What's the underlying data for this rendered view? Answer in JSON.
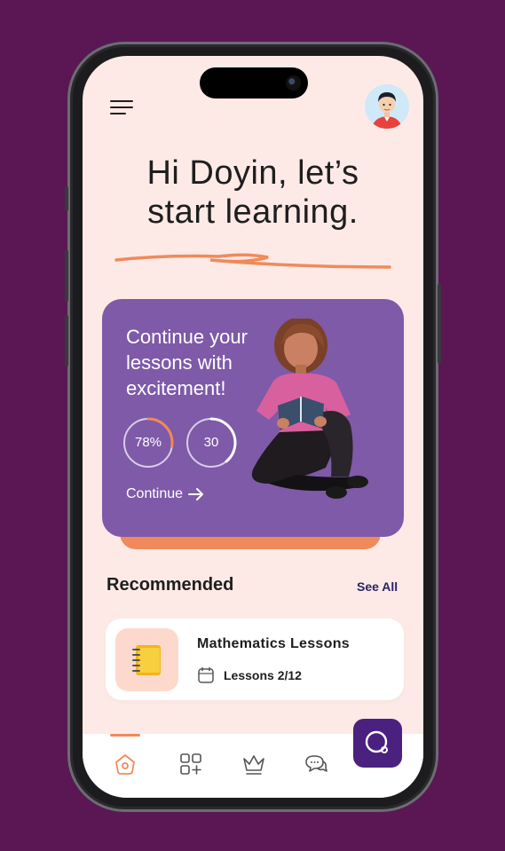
{
  "greeting": {
    "line1": "Hi Doyin, let’s",
    "line2": "start learning."
  },
  "hero": {
    "title_lines": [
      "Continue your",
      "lessons with",
      "excitement!"
    ],
    "progress_percent_label": "78%",
    "progress_percent_value": 0.78,
    "progress_count_label": "30",
    "progress_count_fill": 0.3,
    "continue_label": "Continue"
  },
  "recommended": {
    "title": "Recommended",
    "see_all_label": "See All",
    "items": [
      {
        "title": "Mathematics Lessons",
        "lessons": "Lessons 2/12",
        "icon": "notebook-icon"
      }
    ]
  },
  "tabbar": {
    "tabs": [
      {
        "name": "home",
        "icon": "home-icon",
        "active": true
      },
      {
        "name": "categories",
        "icon": "grid-plus-icon",
        "active": false
      },
      {
        "name": "leaderboard",
        "icon": "crown-icon",
        "active": false
      },
      {
        "name": "messages",
        "icon": "chat-icon",
        "active": false
      }
    ],
    "fab_icon": "search-icon"
  },
  "colors": {
    "background": "#5a1754",
    "screen": "#fdeae6",
    "hero": "#7e5aa8",
    "accent": "#f08a5b",
    "fab": "#4b2180",
    "link": "#2a2466"
  }
}
